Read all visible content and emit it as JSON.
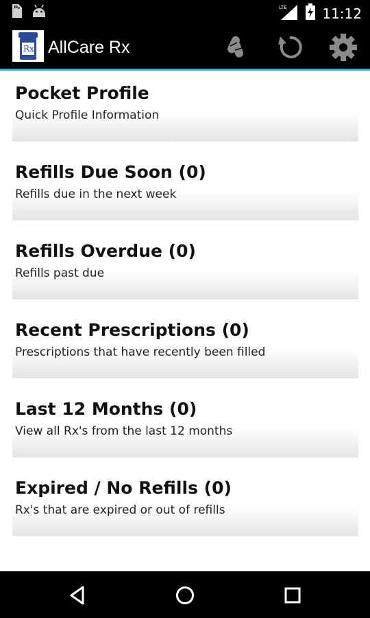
{
  "status_bar": {
    "time": "11:12",
    "network": "LTE",
    "icons": [
      "sd-card-icon",
      "android-icon",
      "lte-signal-icon",
      "battery-charging-icon"
    ]
  },
  "app_bar": {
    "title": "AllCare Rx",
    "logo_text": "Rx",
    "actions": [
      {
        "name": "pill-capsules-icon"
      },
      {
        "name": "refresh-icon"
      },
      {
        "name": "settings-gear-icon"
      }
    ]
  },
  "menu": {
    "items": [
      {
        "title": "Pocket Profile",
        "subtitle": "Quick Profile Information"
      },
      {
        "title": "Refills Due Soon (0)",
        "subtitle": "Refills due in the next week"
      },
      {
        "title": "Refills Overdue (0)",
        "subtitle": "Refills past due"
      },
      {
        "title": "Recent Prescriptions (0)",
        "subtitle": "Prescriptions that have recently been filled"
      },
      {
        "title": "Last 12 Months (0)",
        "subtitle": "View all Rx's from the last 12 months"
      },
      {
        "title": "Expired / No Refills (0)",
        "subtitle": "Rx's that are expired or out of refills"
      }
    ]
  },
  "nav_bar": {
    "buttons": [
      "back-icon",
      "home-icon",
      "recents-icon"
    ]
  },
  "colors": {
    "accent": "#33b5e5",
    "bar_background": "#000000",
    "logo_blue": "#2b4a9a"
  }
}
